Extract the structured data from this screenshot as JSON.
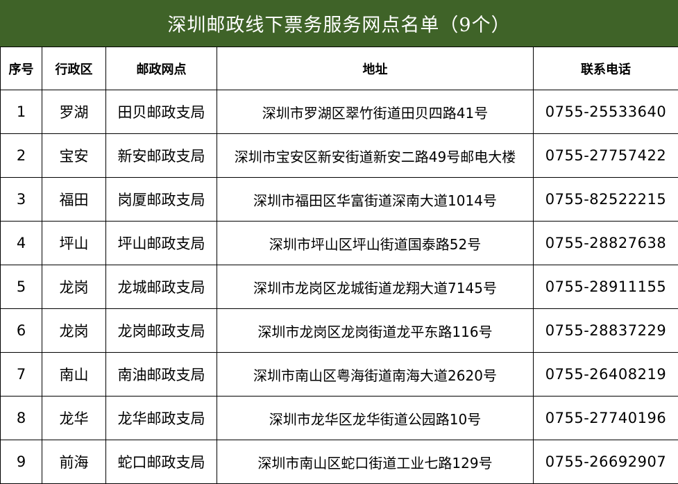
{
  "title": "深圳邮政线下票务服务网点名单（9个）",
  "headers": {
    "index": "序号",
    "district": "行政区",
    "outlet": "邮政网点",
    "address": "地址",
    "phone": "联系电话"
  },
  "rows": [
    {
      "index": "1",
      "district": "罗湖",
      "outlet": "田贝邮政支局",
      "address": "深圳市罗湖区翠竹街道田贝四路41号",
      "phone": "0755-25533640"
    },
    {
      "index": "2",
      "district": "宝安",
      "outlet": "新安邮政支局",
      "address": "深圳市宝安区新安街道新安二路49号邮电大楼",
      "phone": "0755-27757422"
    },
    {
      "index": "3",
      "district": "福田",
      "outlet": "岗厦邮政支局",
      "address": "深圳市福田区华富街道深南大道1014号",
      "phone": "0755-82522215"
    },
    {
      "index": "4",
      "district": "坪山",
      "outlet": "坪山邮政支局",
      "address": "深圳市坪山区坪山街道国泰路52号",
      "phone": "0755-28827638"
    },
    {
      "index": "5",
      "district": "龙岗",
      "outlet": "龙城邮政支局",
      "address": "深圳市龙岗区龙城街道龙翔大道7145号",
      "phone": "0755-28911155"
    },
    {
      "index": "6",
      "district": "龙岗",
      "outlet": "龙岗邮政支局",
      "address": "深圳市龙岗区龙岗街道龙平东路116号",
      "phone": "0755-28837229"
    },
    {
      "index": "7",
      "district": "南山",
      "outlet": "南油邮政支局",
      "address": "深圳市南山区粤海街道南海大道2620号",
      "phone": "0755-26408219"
    },
    {
      "index": "8",
      "district": "龙华",
      "outlet": "龙华邮政支局",
      "address": "深圳市龙华区龙华街道公园路10号",
      "phone": "0755-27740196"
    },
    {
      "index": "9",
      "district": "前海",
      "outlet": "蛇口邮政支局",
      "address": "深圳市南山区蛇口街道工业七路129号",
      "phone": "0755-26692907"
    }
  ],
  "colors": {
    "title_background": "#3f6328",
    "title_text": "#ffffff",
    "grid_lines": "#000000"
  }
}
